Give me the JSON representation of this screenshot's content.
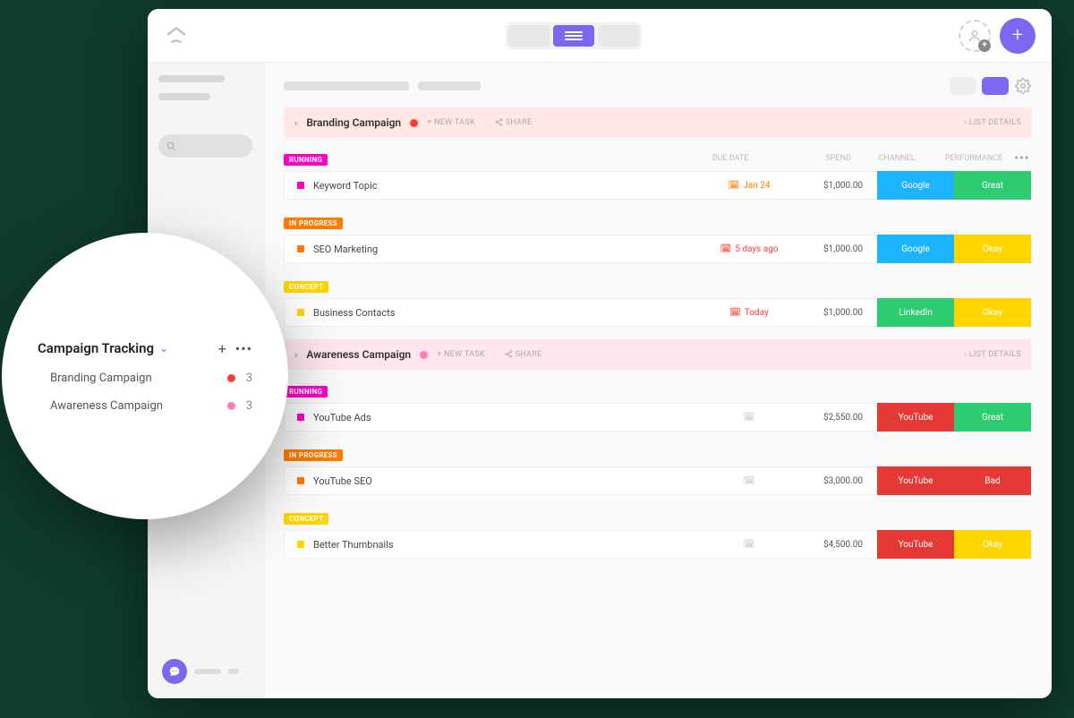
{
  "columns": {
    "due": "DUE DATE",
    "spend": "SPEND",
    "channel": "CHANNEL",
    "performance": "PERFORMANCE"
  },
  "campaigns": [
    {
      "name": "Branding Campaign",
      "dotColor": "red",
      "newTask": "+ NEW TASK",
      "share": "SHARE",
      "listDetails": "LIST DETAILS",
      "groups": [
        {
          "status": "RUNNING",
          "statusClass": "running",
          "dotClass": "magenta",
          "task": "Keyword Topic",
          "due": "Jan 24",
          "dueClass": "jan",
          "spend": "$1,000.00",
          "channel": "Google",
          "channelClass": "google",
          "perf": "Great",
          "perfClass": "great"
        },
        {
          "status": "IN PROGRESS",
          "statusClass": "progress",
          "dotClass": "orange",
          "task": "SEO Marketing",
          "due": "5 days ago",
          "dueClass": "days",
          "spend": "$1,000.00",
          "channel": "Google",
          "channelClass": "google",
          "perf": "Okay",
          "perfClass": "okay"
        },
        {
          "status": "CONCEPT",
          "statusClass": "concept",
          "dotClass": "yellow",
          "task": "Business Contacts",
          "due": "Today",
          "dueClass": "today",
          "spend": "$1,000.00",
          "channel": "LinkedIn",
          "channelClass": "linkedin",
          "perf": "Okay",
          "perfClass": "okay"
        }
      ]
    },
    {
      "name": "Awareness Campaign",
      "dotColor": "pink",
      "newTask": "+ NEW TASK",
      "share": "SHARE",
      "listDetails": "LIST DETAILS",
      "groups": [
        {
          "status": "RUNNING",
          "statusClass": "running",
          "dotClass": "magenta",
          "task": "YouTube Ads",
          "due": "",
          "dueClass": "empty",
          "spend": "$2,550.00",
          "channel": "YouTube",
          "channelClass": "youtube",
          "perf": "Great",
          "perfClass": "great"
        },
        {
          "status": "IN PROGRESS",
          "statusClass": "progress",
          "dotClass": "orange",
          "task": "YouTube SEO",
          "due": "",
          "dueClass": "empty",
          "spend": "$3,000.00",
          "channel": "YouTube",
          "channelClass": "youtube",
          "perf": "Bad",
          "perfClass": "bad"
        },
        {
          "status": "CONCEPT",
          "statusClass": "concept",
          "dotClass": "yellow",
          "task": "Better Thumbnails",
          "due": "",
          "dueClass": "empty",
          "spend": "$4,500.00",
          "channel": "YouTube",
          "channelClass": "youtube",
          "perf": "Okay",
          "perfClass": "okay"
        }
      ]
    }
  ],
  "popover": {
    "title": "Campaign Tracking",
    "items": [
      {
        "label": "Branding Campaign",
        "dot": "red",
        "count": "3"
      },
      {
        "label": "Awareness Campaign",
        "dot": "pink",
        "count": "3"
      }
    ]
  }
}
